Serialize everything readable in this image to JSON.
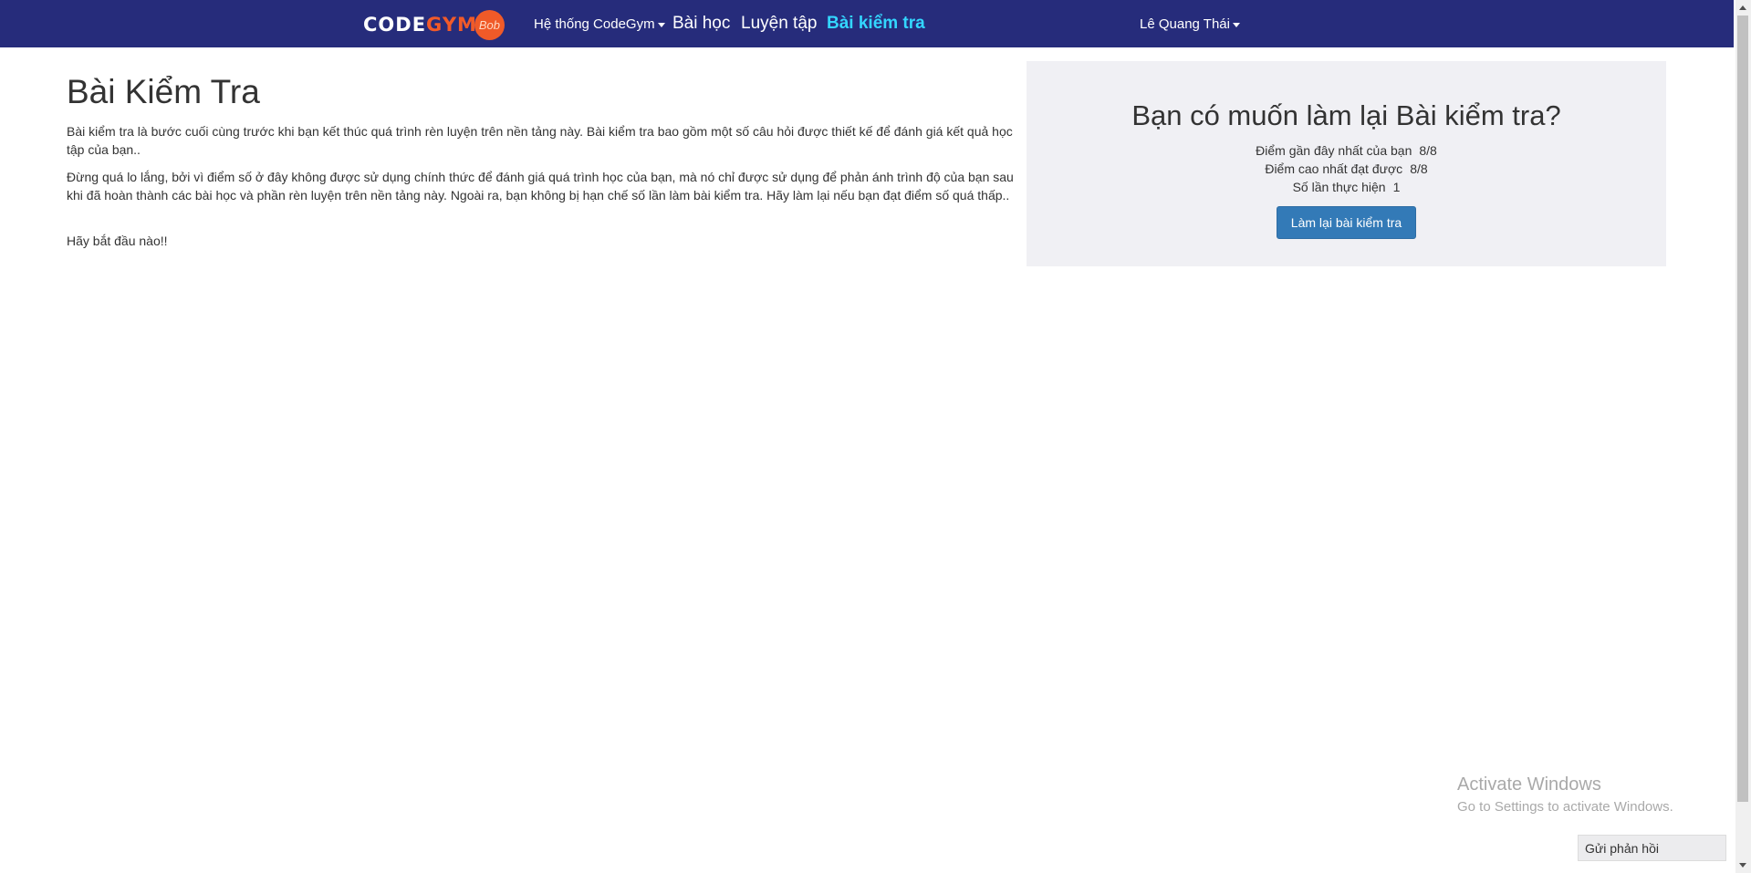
{
  "navbar": {
    "brand_main": "CODEGYM",
    "brand_badge": "Bob",
    "system_menu": "Hệ thống CodeGym",
    "lessons": "Bài học",
    "practice": "Luyện tập",
    "test": "Bài kiểm tra",
    "user_menu": "Lê Quang Thái"
  },
  "main": {
    "title": "Bài Kiểm Tra",
    "paragraphs": [
      "Bài kiểm tra là bước cuối cùng trước khi bạn kết thúc quá trình rèn luyện trên nền tảng này. Bài kiểm tra bao gồm một số câu hỏi được thiết kế để đánh giá kết quả học tập của bạn..",
      "Đừng quá lo lắng, bởi vì điểm số ở đây không được sử dụng chính thức để đánh giá quá trình học của bạn, mà nó chỉ được sử dụng để phản ánh trình độ của bạn sau khi đã hoàn thành các bài học và phần rèn luyện trên nền tảng này. Ngoài ra, bạn không bị hạn chế số lần làm bài kiểm tra. Hãy làm lại nếu bạn đạt điểm số quá thấp..",
      "Hãy bắt đầu nào!!"
    ]
  },
  "retake": {
    "title": "Bạn có muốn làm lại Bài kiểm tra?",
    "recent_score_label": "Điểm gần đây nhất của bạn",
    "recent_score_value": "8/8",
    "best_score_label": "Điểm cao nhất đạt được",
    "best_score_value": "8/8",
    "attempts_label": "Số lần thực hiện",
    "attempts_value": "1",
    "button_label": "Làm lại bài kiểm tra"
  },
  "watermark": {
    "title": "Activate Windows",
    "subtitle": "Go to Settings to activate Windows."
  },
  "feedback": {
    "label": "Gửi phản hồi"
  },
  "colors": {
    "navbar_bg": "#262c7b",
    "active_nav": "#33d6ff",
    "brand_accent": "#f15a29",
    "button_primary": "#337ab7",
    "panel_bg": "#f0f0f4"
  }
}
